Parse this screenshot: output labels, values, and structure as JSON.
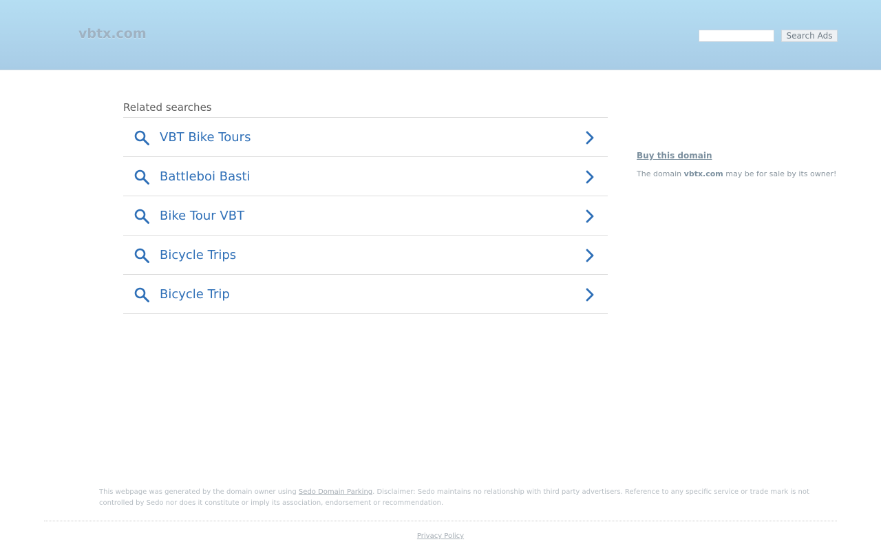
{
  "header": {
    "logo_text": "vbtx.com",
    "search_placeholder": "",
    "search_button_label": "Search Ads"
  },
  "related": {
    "title": "Related searches",
    "items": [
      {
        "label": "VBT Bike Tours"
      },
      {
        "label": "Battleboi Basti"
      },
      {
        "label": "Bike Tour VBT"
      },
      {
        "label": "Bicycle Trips"
      },
      {
        "label": "Bicycle Trip"
      }
    ]
  },
  "sidebar": {
    "buy_link_label": "Buy this domain",
    "buy_text_prefix": "The domain",
    "buy_text_domain": "vbtx.com",
    "buy_text_suffix": "may be for sale by its owner!"
  },
  "footer": {
    "disclaimer_prefix": "This webpage was generated by the domain owner using",
    "disclaimer_link": "Sedo Domain Parking",
    "disclaimer_suffix": ". Disclaimer: Sedo maintains no relationship with third party advertisers. Reference to any specific service or trade mark is not controlled by Sedo nor does it constitute or imply its association, endorsement or recommendation.",
    "privacy_label": "Privacy Policy"
  },
  "colors": {
    "header_top": "#b5def3",
    "header_bottom": "#a8cce6",
    "link_blue": "#2e6fb7",
    "muted_text": "#8a969f"
  }
}
